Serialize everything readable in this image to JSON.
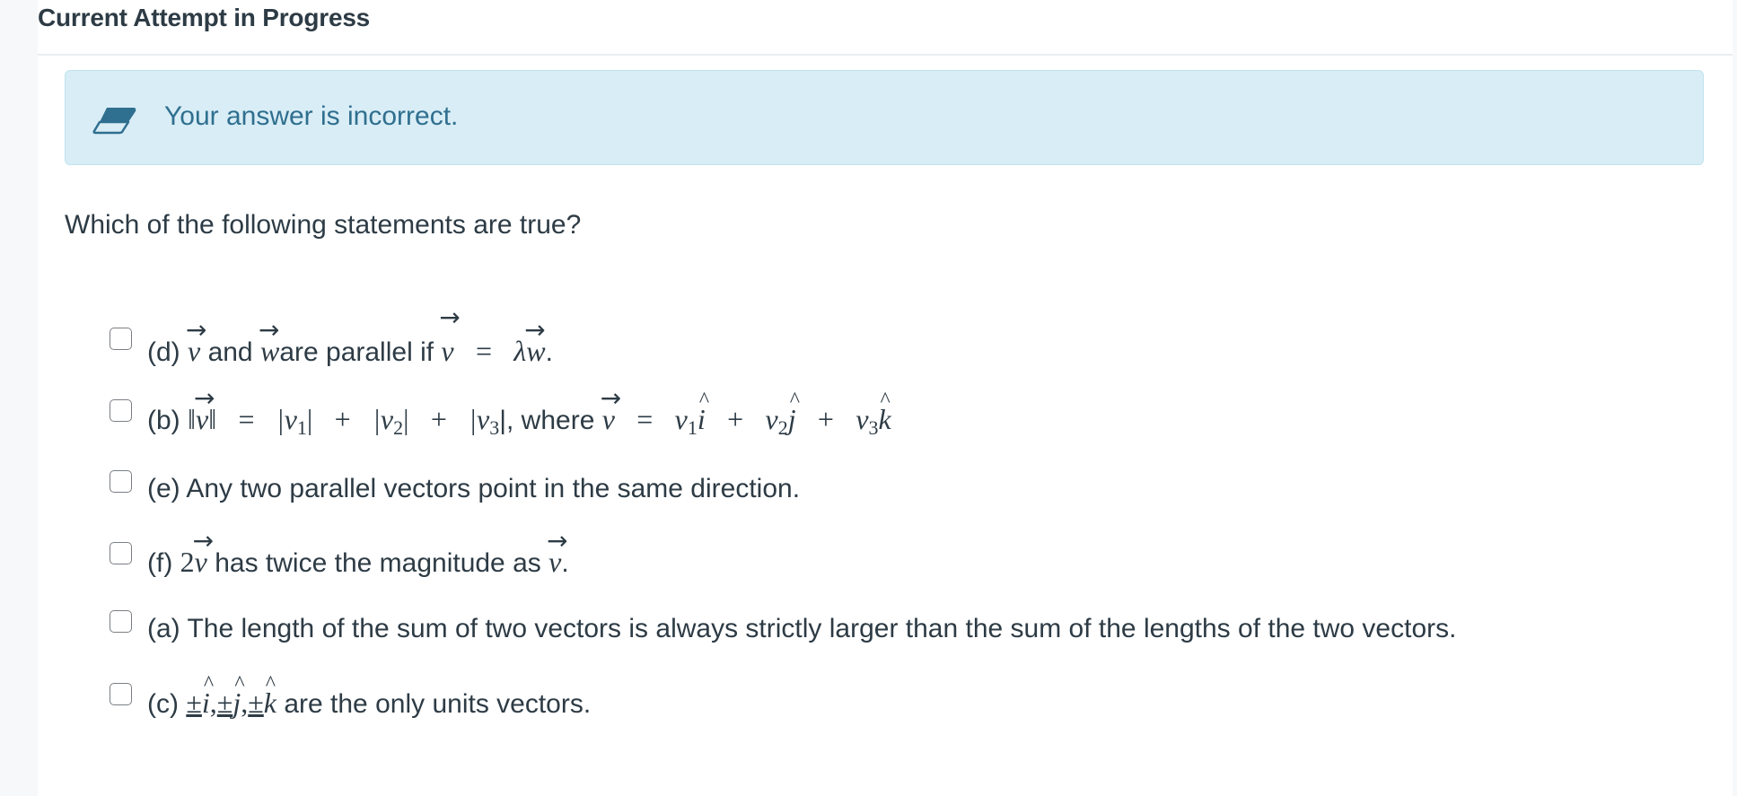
{
  "header": {
    "title": "Current Attempt in Progress"
  },
  "feedback": {
    "icon": "eraser-icon",
    "message": "Your answer is incorrect.",
    "colors": {
      "background": "#d9edf6",
      "text": "#2f6f8f",
      "icon": "#2f6f8f"
    }
  },
  "question": {
    "prompt": "Which of the following statements are true?"
  },
  "options": [
    {
      "id": "d",
      "label": "(d)",
      "checked": false,
      "parts": {
        "v": "v",
        "and": "and",
        "w": "w",
        "are_parallel_if": "are parallel if",
        "eq": "=",
        "lambda": "λ",
        "end": "."
      }
    },
    {
      "id": "b",
      "label": "(b)",
      "checked": false,
      "parts": {
        "norm_open": "‖",
        "v": "v",
        "norm_close": "‖",
        "eq": "=",
        "abs1": "|v",
        "s1": "1",
        "abs_close": "|",
        "plus": "+",
        "abs2": "|v",
        "s2": "2",
        "abs3": "|v",
        "s3": "3",
        "where": "|, where",
        "v1": "v",
        "i": "i",
        "v2": "v",
        "j": "j",
        "v3": "v",
        "k": "k"
      }
    },
    {
      "id": "e",
      "label": "(e)",
      "checked": false,
      "text": "Any two parallel vectors point in the same direction."
    },
    {
      "id": "f",
      "label": "(f)",
      "checked": false,
      "parts": {
        "two": "2",
        "v": "v",
        "middle": "has twice the magnitude as",
        "end": "."
      }
    },
    {
      "id": "a",
      "label": "(a)",
      "checked": false,
      "text": "The length of the sum of two vectors is always strictly larger than the sum of the lengths of the two vectors."
    },
    {
      "id": "c",
      "label": "(c)",
      "checked": false,
      "parts": {
        "pm": "±",
        "i": "i",
        "j": "j",
        "k": "k",
        "comma": ",",
        "rest": "are the only units vectors."
      }
    }
  ]
}
